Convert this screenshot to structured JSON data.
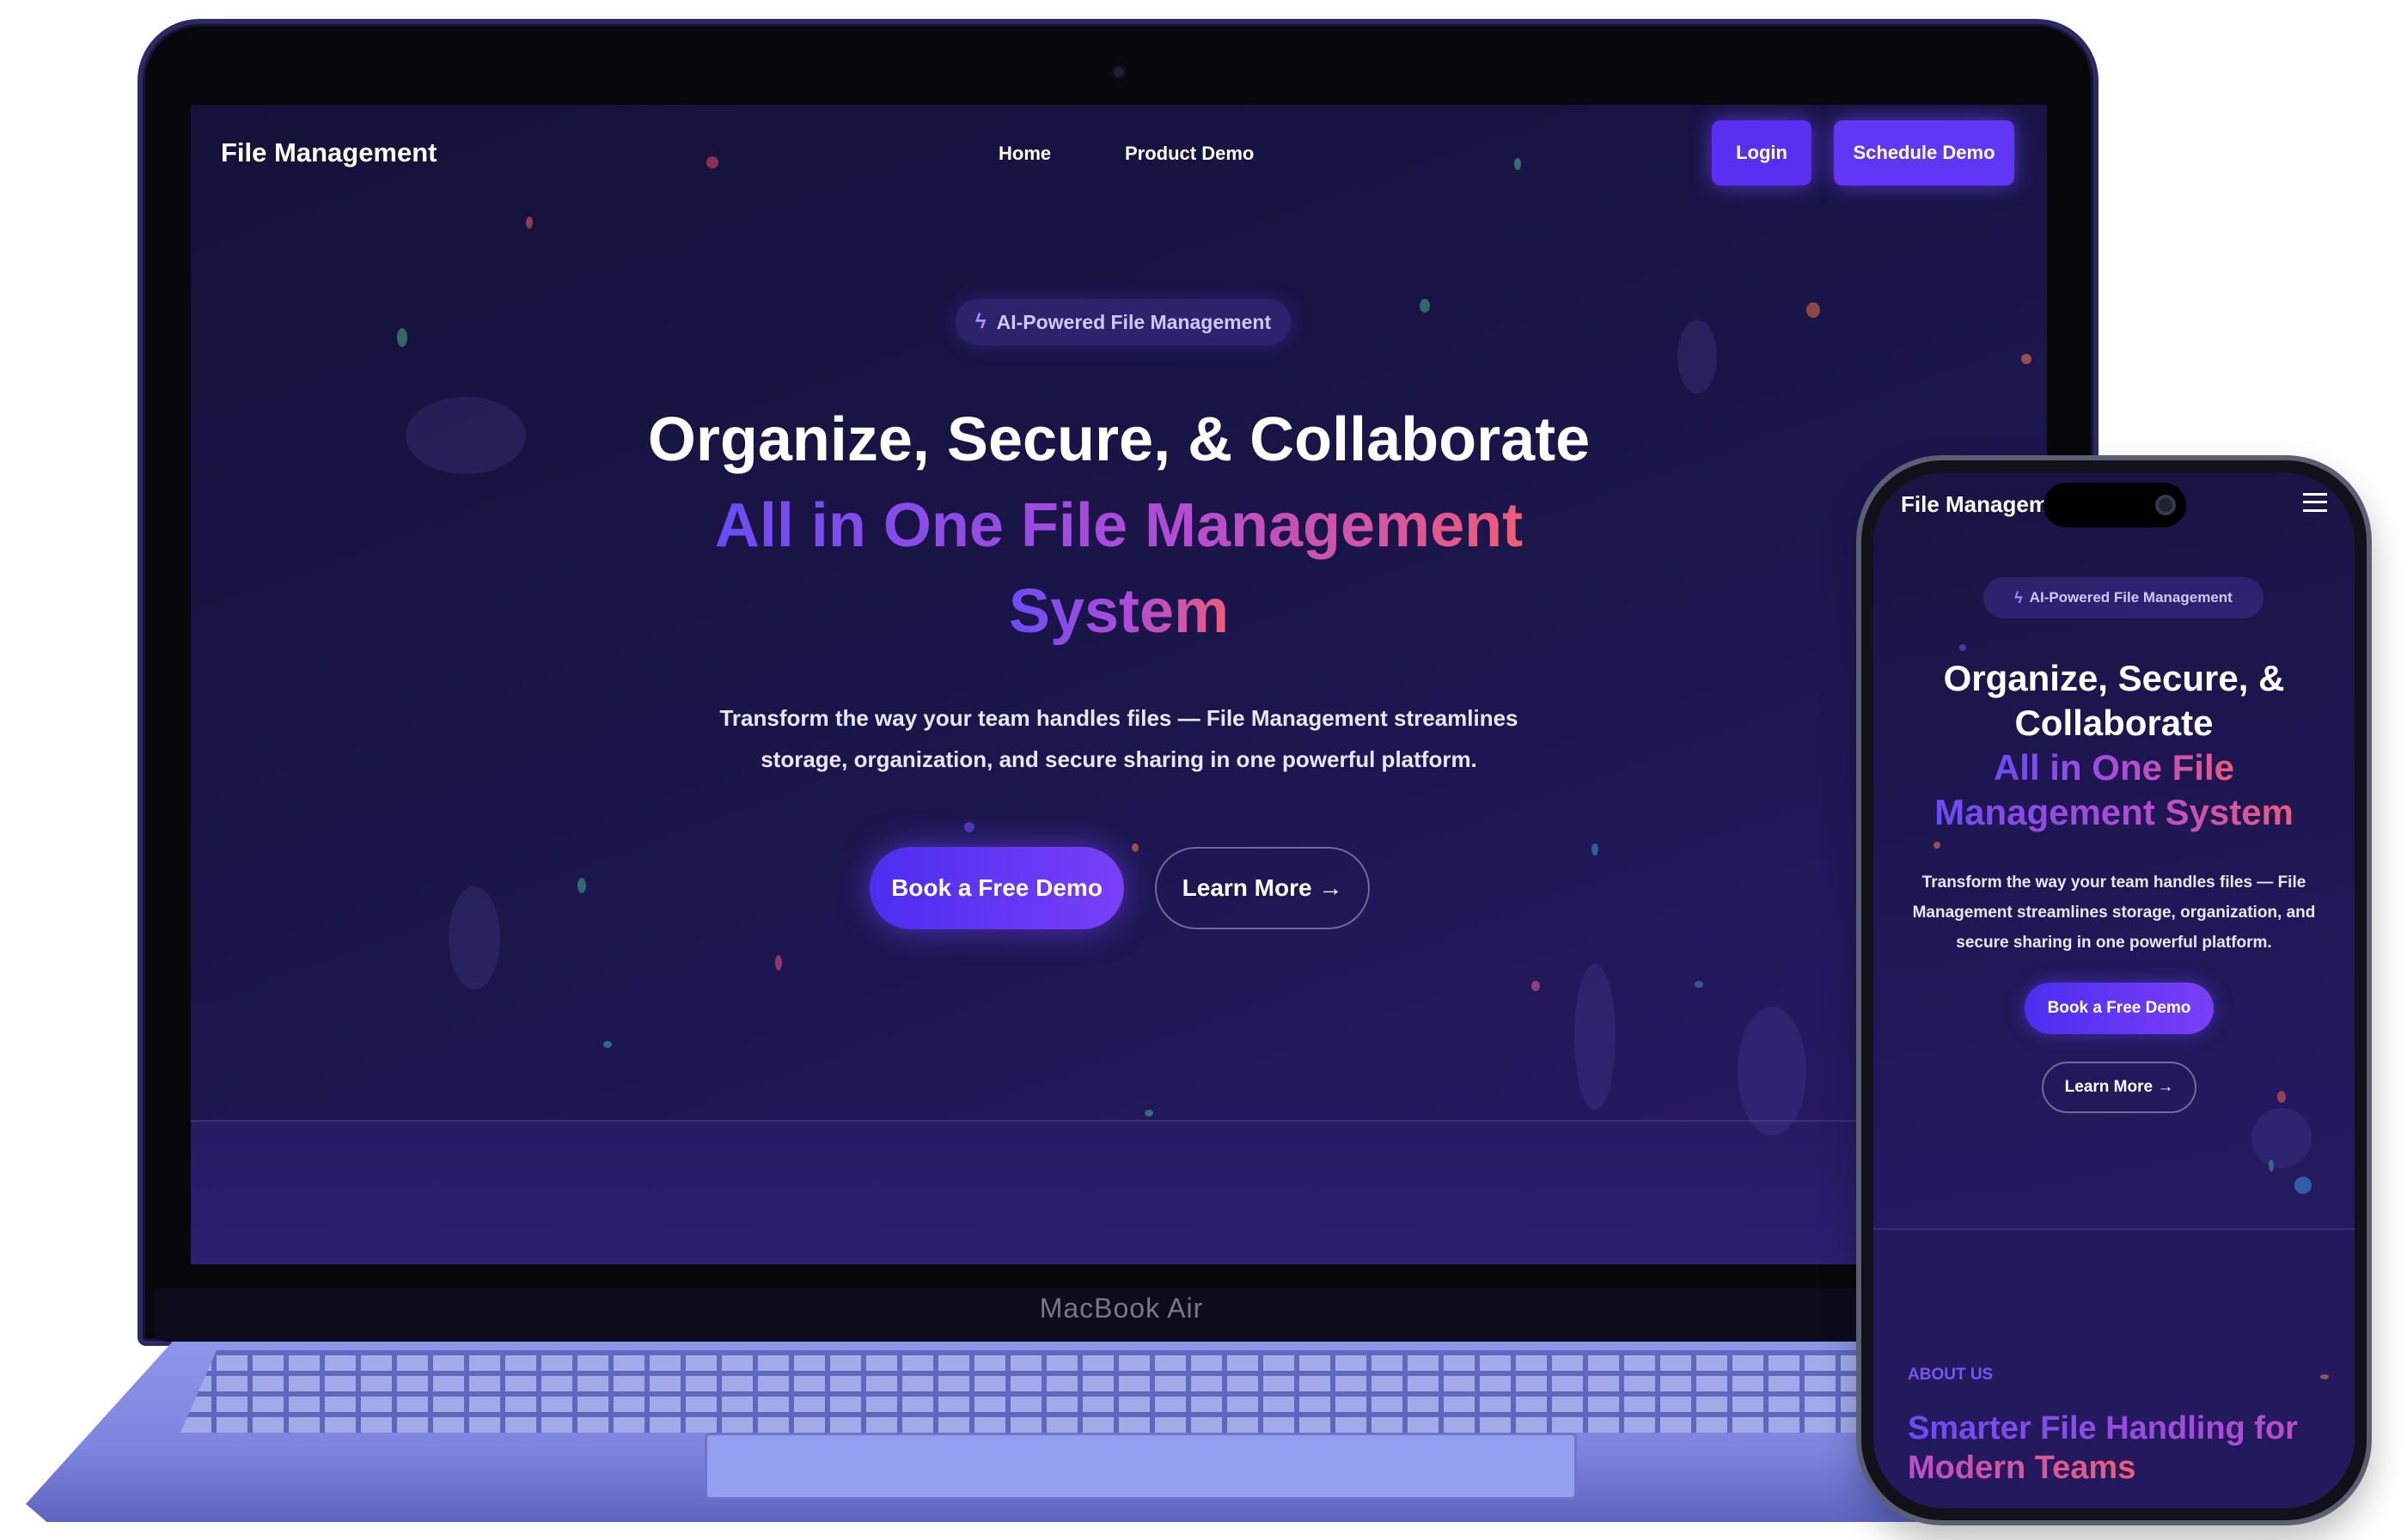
{
  "laptop": {
    "brand": "MacBook Air",
    "site": {
      "logo": "File Management",
      "nav": [
        "Home",
        "Product Demo"
      ],
      "login_label": "Login",
      "schedule_label": "Schedule Demo",
      "badge": "AI-Powered File Management",
      "headline_line1": "Organize, Secure, & Collaborate",
      "headline_line2": "All in One File Management",
      "headline_line3": "System",
      "subtitle": "Transform the way your team handles files — File Management streamlines storage, organization, and secure sharing in one powerful platform.",
      "cta_primary": "Book a Free Demo",
      "cta_secondary": "Learn More →"
    }
  },
  "phone": {
    "logo": "File Management",
    "menu_icon": "hamburger-icon",
    "badge": "AI-Powered File Management",
    "headline_line1": "Organize, Secure, &",
    "headline_line2": "Collaborate",
    "headline_line3": "All in One File",
    "headline_line4": "Management System",
    "subtitle": "Transform the way your team handles files — File Management streamlines storage, organization, and secure sharing in one powerful platform.",
    "cta_primary": "Book a Free Demo",
    "cta_secondary": "Learn More →",
    "about_label": "ABOUT US",
    "about_heading": "Smarter File Handling for Modern Teams"
  },
  "colors": {
    "bg_dark": "#15123a",
    "accent_purple": "#5a2ff2",
    "gradient_start": "#6a4cf5",
    "gradient_end": "#ef5c78"
  },
  "icons": {
    "badge_icon": "lightning-bolt-icon"
  }
}
